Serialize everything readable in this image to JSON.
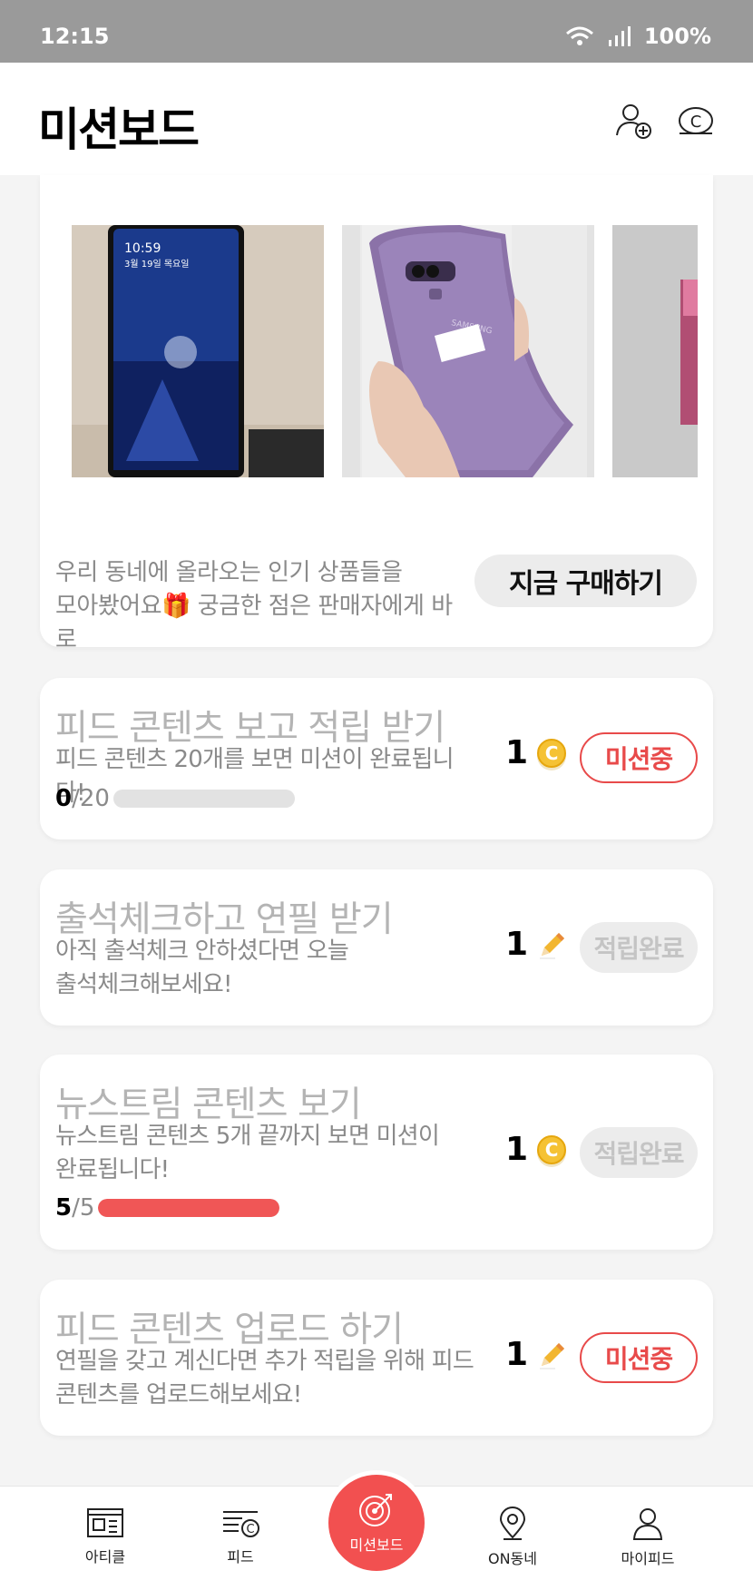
{
  "status_bar": {
    "time": "12:15",
    "battery": "100%"
  },
  "header": {
    "title": "미션보드",
    "icons": [
      "add-friend-icon",
      "coin-icon"
    ]
  },
  "promo": {
    "text_line1": "우리 동네에 올라오는 인기 상품들을",
    "text_line2": "모아봤어요🎁 궁금한 점은 판매자에게 바로",
    "button_label": "지금 구매하기",
    "photo_ids": [
      "phone-photo-1",
      "phone-photo-2",
      "phone-photo-3"
    ],
    "photo1_time": "10:59",
    "photo1_date": "3월 19일 목요일",
    "photo2_brand": "SAMSUNG"
  },
  "missions": [
    {
      "title": "피드 콘텐츠 보고 적립 받기",
      "desc_line1": "피드 콘텐츠 20개를 보면 미션이 완료됩니다!",
      "desc_line2": "",
      "progress_current": "0",
      "progress_total": "/20",
      "progress_fraction": 0,
      "reward": "1",
      "reward_icon": "coin-icon",
      "status": "미션중"
    },
    {
      "title": "출석체크하고 연필 받기",
      "desc_line1": "아직 출석체크 안하셨다면 오늘",
      "desc_line2": "출석체크해보세요!",
      "reward": "1",
      "reward_icon": "pencil-icon",
      "status": "적립완료"
    },
    {
      "title": "뉴스트림 콘텐츠 보기",
      "desc_line1": "뉴스트림 콘텐츠 5개 끝까지 보면 미션이",
      "desc_line2": "완료됩니다!",
      "progress_current": "5",
      "progress_total": "/5",
      "progress_fraction": 1,
      "reward": "1",
      "reward_icon": "coin-icon",
      "status": "적립완료"
    },
    {
      "title": "피드 콘텐츠 업로드 하기",
      "desc_line1": "연필을 갖고 계신다면 추가 적립을 위해 피드",
      "desc_line2": "콘텐츠를 업로드해보세요!",
      "reward": "1",
      "reward_icon": "pencil-icon",
      "status": "미션중"
    }
  ],
  "nav": [
    {
      "label": "아티클",
      "icon": "article-icon"
    },
    {
      "label": "피드",
      "icon": "feed-icon"
    },
    {
      "label": "미션보드",
      "icon": "target-icon"
    },
    {
      "label": "ON동네",
      "icon": "location-pin-icon"
    },
    {
      "label": "마이피드",
      "icon": "person-icon"
    }
  ],
  "colors": {
    "accent": "#f05656",
    "coin": "#f5c234",
    "pill_done_bg": "#ececec"
  }
}
